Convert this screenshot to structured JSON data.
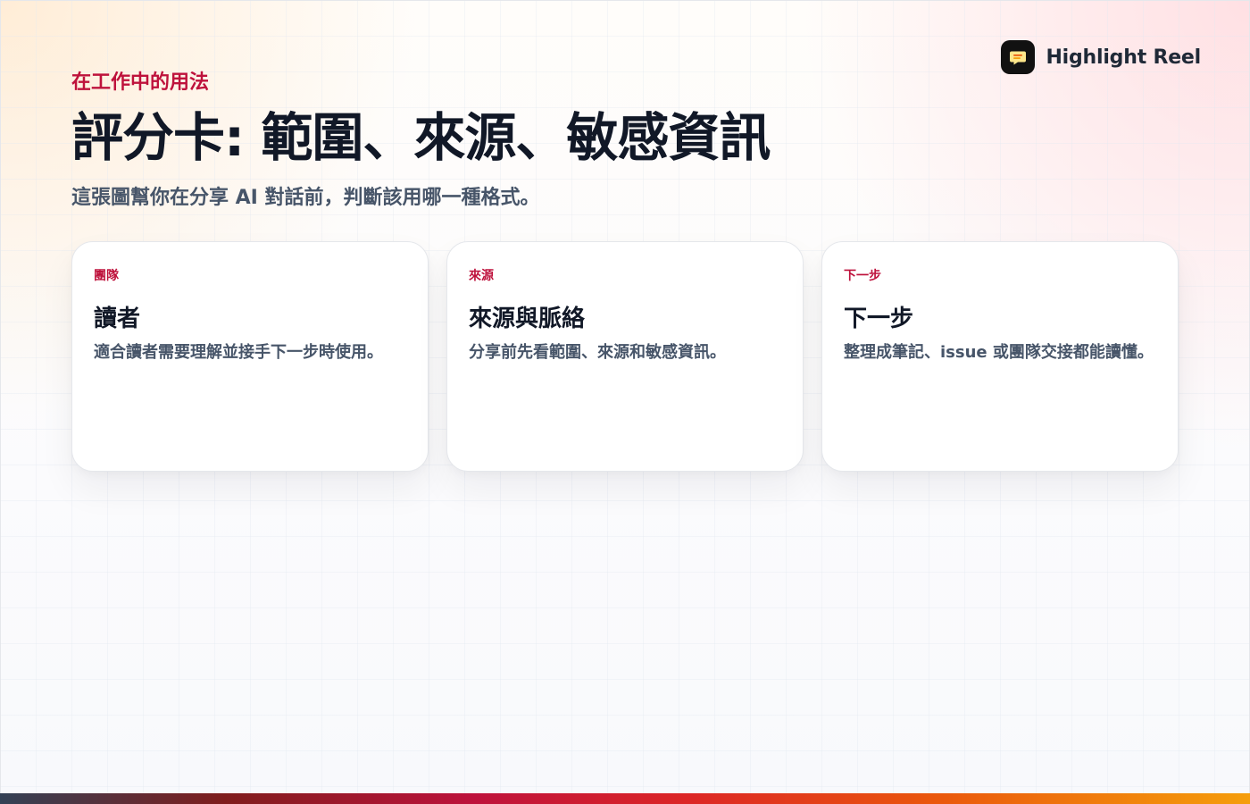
{
  "brand": {
    "icon": "message-icon",
    "name": "Highlight Reel"
  },
  "header": {
    "eyebrow": "在工作中的用法",
    "title": "評分卡: 範圍、來源、敏感資訊",
    "subtitle": "這張圖幫你在分享 AI 對話前，判斷該用哪一種格式。"
  },
  "cards": [
    {
      "kicker": "團隊",
      "title": "讀者",
      "text": "適合讀者需要理解並接手下一步時使用。"
    },
    {
      "kicker": "來源",
      "title": "來源與脈絡",
      "text": "分享前先看範圍、來源和敏感資訊。"
    },
    {
      "kicker": "下一步",
      "title": "下一步",
      "text": "整理成筆記、issue 或團隊交接都能讀懂。"
    }
  ],
  "colors": {
    "accent": "#be123c",
    "title": "#111827",
    "muted": "#475569"
  }
}
